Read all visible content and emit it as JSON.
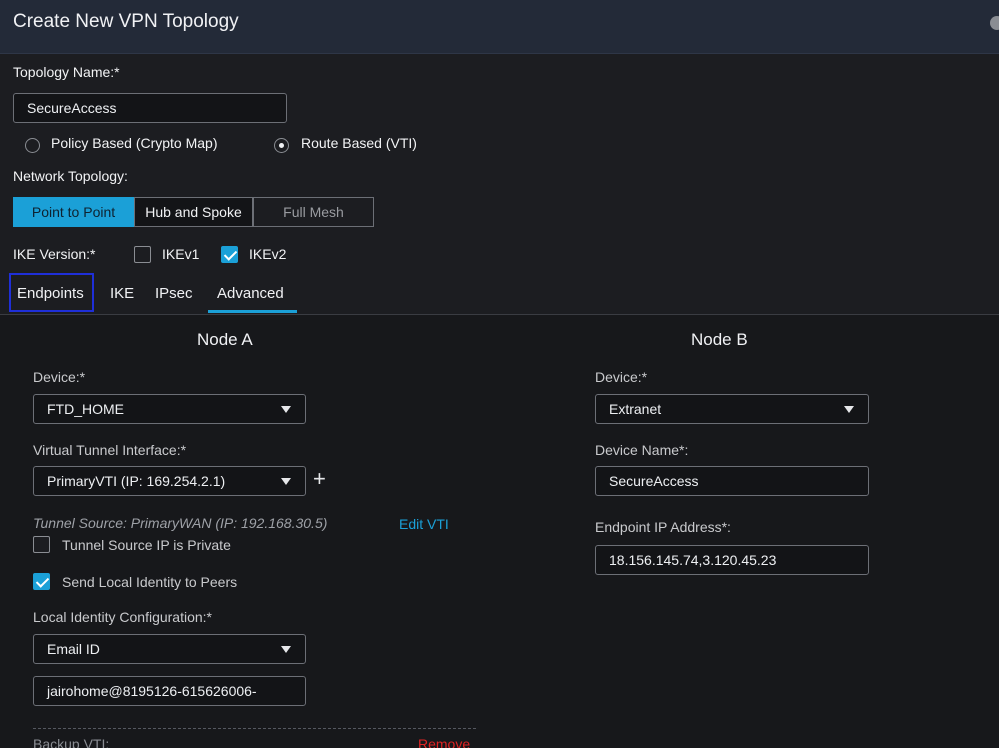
{
  "header": {
    "title": "Create New VPN Topology"
  },
  "topology": {
    "name_label": "Topology Name:*",
    "name_value": "SecureAccess",
    "policy_based_label": "Policy Based (Crypto Map)",
    "route_based_label": "Route Based (VTI)",
    "selected": "Route Based (VTI)"
  },
  "network_topology": {
    "label": "Network Topology:",
    "options": [
      "Point to Point",
      "Hub and Spoke",
      "Full Mesh"
    ],
    "selected": "Point to Point"
  },
  "ike": {
    "label": "IKE Version:*",
    "ikev1_label": "IKEv1",
    "ikev1_checked": false,
    "ikev2_label": "IKEv2",
    "ikev2_checked": true
  },
  "tabs": [
    "Endpoints",
    "IKE",
    "IPsec",
    "Advanced"
  ],
  "node_a": {
    "title": "Node A",
    "device_label": "Device:*",
    "device_value": "FTD_HOME",
    "vti_label": "Virtual Tunnel Interface:*",
    "vti_value": "PrimaryVTI (IP: 169.254.2.1)",
    "add_symbol": "+",
    "tunnel_source_text": "Tunnel Source: PrimaryWAN (IP: 192.168.30.5)",
    "edit_vti_label": "Edit VTI",
    "tunnel_private_label": "Tunnel Source IP is Private",
    "tunnel_private_checked": false,
    "send_identity_label": "Send Local Identity to Peers",
    "send_identity_checked": true,
    "local_identity_label": "Local Identity Configuration:*",
    "local_identity_value": "Email ID",
    "email_value": "jairohome@8195126-615626006-",
    "backup_vti_label": "Backup VTI:",
    "remove_label": "Remove"
  },
  "node_b": {
    "title": "Node B",
    "device_label": "Device:*",
    "device_value": "Extranet",
    "device_name_label": "Device Name*:",
    "device_name_value": "SecureAccess",
    "endpoint_ip_label": "Endpoint IP Address*:",
    "endpoint_ip_value": "18.156.145.74,3.120.45.23"
  },
  "colors": {
    "accent": "#1ba0d7",
    "background": "#17181b",
    "header_bg": "#232a38",
    "remove": "#e02424",
    "focus_ring": "#1f2fd8"
  }
}
